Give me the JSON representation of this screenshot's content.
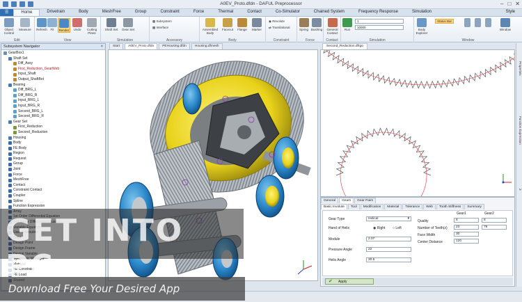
{
  "window": {
    "title": "A0EV_Proto.dfdn - DAFUL Preprocessor",
    "controls": [
      "–",
      "□",
      "✕"
    ],
    "style_label": "Style"
  },
  "menu_tabs": [
    "Home",
    "Drivetrain",
    "Body",
    "MeshFree",
    "Group",
    "Constraint",
    "Force",
    "Thermal",
    "Contact",
    "Co-Simulator",
    "Chained System",
    "Frequency Response",
    "Simulation"
  ],
  "ribbon": {
    "groups": [
      "Edit",
      "View",
      "Simulation",
      "Accessory",
      "Body",
      "Constraint",
      "Force",
      "Contact",
      "Simulation",
      "Window"
    ],
    "buttons": {
      "object_control": "Object Control",
      "measure": "Measure",
      "refresh": "Refresh",
      "fit": "Fit",
      "render": "Render",
      "undo": "Undo",
      "cutting_plane": "Cutting Plane",
      "shaft_set": "Shaft Set",
      "gear_set": "Gear Set",
      "subsystem": "Subsystem",
      "interface": "Interface",
      "assembled_body": "Assembled Body",
      "facecut": "Facecut",
      "flange": "Flange",
      "marker": "Marker",
      "revolute": "Revolute",
      "translational": "Translational",
      "spring": "Spring",
      "bushing": "Bushing",
      "general_contact": "General Contact",
      "run": "Run",
      "body_explorer": "Body Explorer",
      "status_bar": "Status Bar",
      "window_ctrl": "Window"
    },
    "sim_time_value": "1",
    "sim_steps_value": "10000"
  },
  "navigator": {
    "title": "Subsystem Navigator",
    "items": [
      {
        "label": "GearBox1",
        "level": 0,
        "color": "#6b8fb8"
      },
      {
        "label": "Shaft Set",
        "level": 1,
        "color": "#4a7ab0"
      },
      {
        "label": "Diff_Assy",
        "level": 2,
        "color": "#c08a2a"
      },
      {
        "label": "First_Reduction_GearWeb",
        "level": 2,
        "color": "#c08a2a",
        "red": true
      },
      {
        "label": "Input_Shaft",
        "level": 2,
        "color": "#c08a2a"
      },
      {
        "label": "Output_ShaftBot",
        "level": 2,
        "color": "#c08a2a"
      },
      {
        "label": "Bearing",
        "level": 1,
        "color": "#4a7ab0"
      },
      {
        "label": "Diff_BRG_L",
        "level": 2,
        "color": "#5aa0d0"
      },
      {
        "label": "Diff_BRG_R",
        "level": 2,
        "color": "#5aa0d0"
      },
      {
        "label": "Input_BRG_L",
        "level": 2,
        "color": "#5aa0d0"
      },
      {
        "label": "Input_BRG_R",
        "level": 2,
        "color": "#5aa0d0"
      },
      {
        "label": "Second_BRG_L",
        "level": 2,
        "color": "#5aa0d0"
      },
      {
        "label": "Second_BRG_R",
        "level": 2,
        "color": "#5aa0d0"
      },
      {
        "label": "Gear Set",
        "level": 1,
        "color": "#4a7ab0"
      },
      {
        "label": "First_Reduction",
        "level": 2,
        "color": "#7a9a3a"
      },
      {
        "label": "Second_Reduction",
        "level": 2,
        "color": "#7a9a3a"
      },
      {
        "label": "Housing",
        "level": 1,
        "color": "#4a7ab0"
      },
      {
        "label": "Body",
        "level": 1,
        "color": "#3a6aa8"
      },
      {
        "label": "FE Body",
        "level": 1,
        "color": "#3a6aa8"
      },
      {
        "label": "Region",
        "level": 1,
        "color": "#3a6aa8"
      },
      {
        "label": "Request",
        "level": 1,
        "color": "#3a6aa8"
      },
      {
        "label": "Group",
        "level": 1,
        "color": "#3a6aa8"
      },
      {
        "label": "Joint",
        "level": 1,
        "color": "#3a6aa8"
      },
      {
        "label": "Force",
        "level": 1,
        "color": "#3a6aa8"
      },
      {
        "label": "MeshFree",
        "level": 1,
        "color": "#3a6aa8"
      },
      {
        "label": "Contact",
        "level": 1,
        "color": "#3a6aa8"
      },
      {
        "label": "Constraint Contact",
        "level": 1,
        "color": "#3a6aa8"
      },
      {
        "label": "Coupler",
        "level": 1,
        "color": "#3a6aa8"
      },
      {
        "label": "Spline",
        "level": 1,
        "color": "#3a6aa8"
      },
      {
        "label": "Function Expression",
        "level": 1,
        "color": "#3a6aa8"
      },
      {
        "label": "Array",
        "level": 1,
        "color": "#3a6aa8"
      },
      {
        "label": "1st Order Differential Equation",
        "level": 1,
        "color": "#3a6aa8"
      },
      {
        "label": "2nd Order Differential Equation",
        "level": 1,
        "color": "#3a6aa8"
      },
      {
        "label": "Variable Equation",
        "level": 1,
        "color": "#3a6aa8"
      },
      {
        "label": "User Subroutine",
        "level": 1,
        "color": "#3a6aa8"
      },
      {
        "label": "Solid",
        "level": 1,
        "color": "#3a6aa8"
      },
      {
        "label": "Design Point",
        "level": 1,
        "color": "#3a6aa8"
      },
      {
        "label": "Design Frame",
        "level": 1,
        "color": "#3a6aa8"
      },
      {
        "label": "Design Variable",
        "level": 1,
        "color": "#3a6aa8"
      },
      {
        "label": "Symmetric Manager",
        "level": 1,
        "color": "#3a6aa8"
      },
      {
        "label": "Material",
        "level": 1,
        "color": "#3a6aa8"
      },
      {
        "label": "FE Constraint",
        "level": 1,
        "color": "#3a6aa8"
      },
      {
        "label": "FE Load",
        "level": 1,
        "color": "#3a6aa8"
      },
      {
        "label": "Shared",
        "level": 1,
        "color": "#3a6aa8"
      }
    ]
  },
  "doc_tabs": [
    "Start",
    "A0EV_Proto.dfdn",
    "PEHousing.dfdn",
    "Housing.dfmesh"
  ],
  "doc_tab_right": "Second_Reduction.dfrgo",
  "panel": {
    "tabs_top": [
      "General",
      "Gears",
      "Gear Pairs"
    ],
    "tabs_sub": [
      "Basic Involute",
      "Tool",
      "Modification",
      "Material",
      "Tolerance",
      "Web",
      "Tooth Stiffness",
      "Summary"
    ],
    "gear_type_label": "Gear Type",
    "gear_type_value": "Helical",
    "hand_label": "Hand of Helix",
    "hand_right": "Right",
    "hand_left": "Left",
    "module_label": "Module",
    "module_value": "2.07",
    "pressure_label": "Pressure Angle",
    "pressure_value": "22",
    "helix_label": "Helix Angle",
    "helix_value": "30.5",
    "gear1_header": "Gear1",
    "gear2_header": "Gear2",
    "quality_label": "Quality",
    "quality_g1": "8",
    "quality_g2": "8",
    "teeth_label": "Number of Teeth(z)",
    "teeth_g1": "23",
    "teeth_g2": "79",
    "face_label": "Face Width",
    "face_value": "30",
    "center_label": "Center Distance",
    "center_value": "120",
    "apply_label": "Apply"
  },
  "right_strip": [
    "Properties",
    "Function Expression",
    "Z"
  ],
  "watermark": {
    "big": "GET INTO PC",
    "small": "Download Free Your Desired App"
  },
  "colors": {
    "accent": "#2f6fb5",
    "gear_gray": "#9da3a8",
    "bearing_blue": "#2a86c8",
    "ring_yellow": "#e8d21a",
    "profile_red": "#e0303a"
  }
}
